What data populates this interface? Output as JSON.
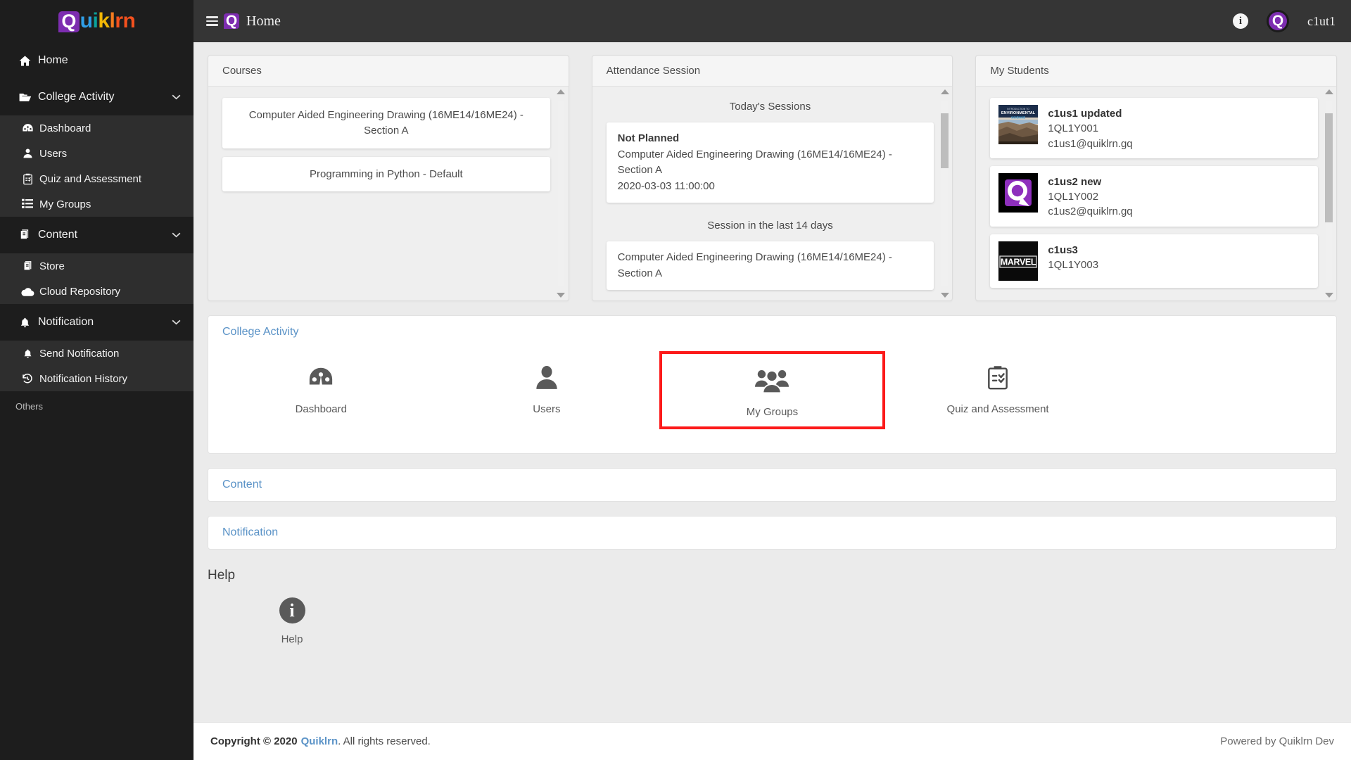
{
  "brand": {
    "logo_letters": [
      {
        "char": "Q",
        "color": "#ffffff"
      },
      {
        "char": "u",
        "color": "#2f9fe8"
      },
      {
        "char": "i",
        "color": "#0aa19a"
      },
      {
        "char": "k",
        "color": "#f2b705"
      },
      {
        "char": "l",
        "color": "#f57c1f"
      },
      {
        "char": "r",
        "color": "#f4511e"
      },
      {
        "char": "n",
        "color": "#f4511e"
      }
    ],
    "badge_color": "#7d2db0",
    "accent_link": "#5b93c7",
    "highlight_color": "#fc1a1a"
  },
  "topbar": {
    "menu_icon": "hamburger-icon",
    "logo_mark": "quiklrn-q-mark",
    "title": "Home",
    "info_icon": "info-icon",
    "avatar_icon": "user-avatar-q",
    "user_name": "c1ut1"
  },
  "sidebar": {
    "items": [
      {
        "label": "Home",
        "icon": "home-icon",
        "type": "item",
        "expandable": false
      },
      {
        "label": "College Activity",
        "icon": "folder-open-icon",
        "type": "group",
        "expandable": true,
        "chevron": "chevron-down-icon"
      },
      {
        "label": "Dashboard",
        "icon": "dashboard-gauge-icon",
        "type": "sub"
      },
      {
        "label": "Users",
        "icon": "user-icon",
        "type": "sub"
      },
      {
        "label": "Quiz and Assessment",
        "icon": "clipboard-check-icon",
        "type": "sub"
      },
      {
        "label": "My Groups",
        "icon": "list-icon",
        "type": "sub"
      },
      {
        "label": "Content",
        "icon": "book-icon",
        "type": "group",
        "expandable": true,
        "chevron": "chevron-down-icon"
      },
      {
        "label": "Store",
        "icon": "book-icon",
        "type": "sub"
      },
      {
        "label": "Cloud Repository",
        "icon": "cloud-icon",
        "type": "sub"
      },
      {
        "label": "Notification",
        "icon": "bell-icon",
        "type": "group",
        "expandable": true,
        "chevron": "chevron-down-icon"
      },
      {
        "label": "Send Notification",
        "icon": "bell-icon",
        "type": "sub"
      },
      {
        "label": "Notification History",
        "icon": "history-icon",
        "type": "sub"
      }
    ],
    "others_label": "Others"
  },
  "cards": {
    "courses": {
      "title": "Courses",
      "tiles": [
        "Computer Aided Engineering Drawing (16ME14/16ME24) - Section A",
        "Programming in Python - Default"
      ],
      "scroll": {
        "up": "scroll-up-arrow",
        "down": "scroll-down-arrow",
        "thumb_visible": false
      }
    },
    "attendance": {
      "title": "Attendance Session",
      "today_heading": "Today's Sessions",
      "today_session": {
        "status": "Not Planned",
        "course": "Computer Aided Engineering Drawing (16ME14/16ME24) - Section A",
        "datetime": "2020-03-03 11:00:00"
      },
      "last14_heading": "Session in the last 14 days",
      "last14_session": "Computer Aided Engineering Drawing (16ME14/16ME24) - Section A",
      "scroll": {
        "up": "scroll-up-arrow",
        "down": "scroll-down-arrow",
        "thumb_visible": true
      }
    },
    "students": {
      "title": "My Students",
      "list": [
        {
          "name": "c1us1 updated",
          "id": "1QL1Y001",
          "email": "c1us1@quiklrn.gq",
          "thumb": "environmental-science-book-cover"
        },
        {
          "name": "c1us2 new",
          "id": "1QL1Y002",
          "email": "c1us2@quiklrn.gq",
          "thumb": "quiklrn-q-logo"
        },
        {
          "name": "c1us3",
          "id": "1QL1Y003",
          "email": "",
          "thumb": "marvel-logo"
        }
      ],
      "scroll": {
        "up": "scroll-up-arrow",
        "down": "scroll-down-arrow",
        "thumb_visible": true
      }
    }
  },
  "panels": [
    {
      "title": "College Activity",
      "expanded": true,
      "tiles": [
        {
          "label": "Dashboard",
          "icon": "dashboard-gauge-icon",
          "highlighted": false
        },
        {
          "label": "Users",
          "icon": "user-icon",
          "highlighted": false
        },
        {
          "label": "My Groups",
          "icon": "users-group-icon",
          "highlighted": true
        },
        {
          "label": "Quiz and Assessment",
          "icon": "clipboard-check-icon",
          "highlighted": false
        }
      ]
    },
    {
      "title": "Content",
      "expanded": false,
      "tiles": []
    },
    {
      "title": "Notification",
      "expanded": false,
      "tiles": []
    }
  ],
  "help": {
    "heading": "Help",
    "tile_label": "Help",
    "icon": "info-circle-icon"
  },
  "footer": {
    "copyright_prefix": "Copyright © 2020",
    "brand": "Quiklrn",
    "copyright_suffix": ". All rights reserved.",
    "powered_by": "Powered by Quiklrn Dev"
  }
}
